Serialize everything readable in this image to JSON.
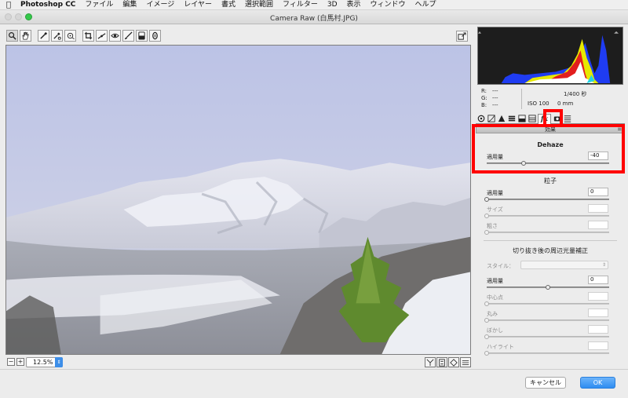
{
  "menubar": {
    "apple_icon": "apple-icon",
    "items": [
      "Photoshop CC",
      "ファイル",
      "編集",
      "イメージ",
      "レイヤー",
      "書式",
      "選択範囲",
      "フィルター",
      "3D",
      "表示",
      "ウィンドウ",
      "ヘルプ"
    ]
  },
  "window": {
    "title": "Camera Raw (白馬村.JPG)"
  },
  "toolbar": {
    "tools": [
      "zoom-icon",
      "hand-icon",
      "white-balance-icon",
      "color-sampler-icon",
      "target-adjust-icon",
      "crop-icon",
      "straighten-icon",
      "red-eye-icon",
      "adjustment-brush-icon",
      "graduated-filter-icon",
      "radial-filter-icon"
    ],
    "export_icon": "export-icon"
  },
  "info": {
    "r_label": "R:",
    "g_label": "G:",
    "b_label": "B:",
    "r_value": "---",
    "g_value": "---",
    "b_value": "---",
    "shutter": "1/400 秒",
    "iso": "ISO 100",
    "focal": "0 mm"
  },
  "panel_tabs": [
    "basic-icon",
    "tone-curve-icon",
    "detail-icon",
    "hsl-icon",
    "split-toning-icon",
    "lens-icon",
    "fx-icon",
    "camera-calibration-icon",
    "presets-icon"
  ],
  "effects": {
    "header": "効果",
    "dehaze": {
      "title": "Dehaze",
      "amount_label": "適用量",
      "amount_value": "-40",
      "slider_value": -40,
      "slider_range": [
        -100,
        100
      ]
    },
    "grain": {
      "title": "粒子",
      "amount_label": "適用量",
      "amount_value": "0",
      "size_label": "サイズ",
      "roughness_label": "粗さ"
    },
    "vignette": {
      "title": "切り抜き後の周辺光量補正",
      "style_label": "スタイル：",
      "amount_label": "適用量",
      "amount_value": "0",
      "midpoint_label": "中心点",
      "roundness_label": "丸み",
      "feather_label": "ぼかし",
      "highlights_label": "ハイライト"
    }
  },
  "zoom": {
    "level": "12.5%"
  },
  "buttons": {
    "cancel": "キャンセル",
    "ok": "OK"
  },
  "colors": {
    "highlight": "#ff0000",
    "ok_button": "#2f8cf1"
  }
}
